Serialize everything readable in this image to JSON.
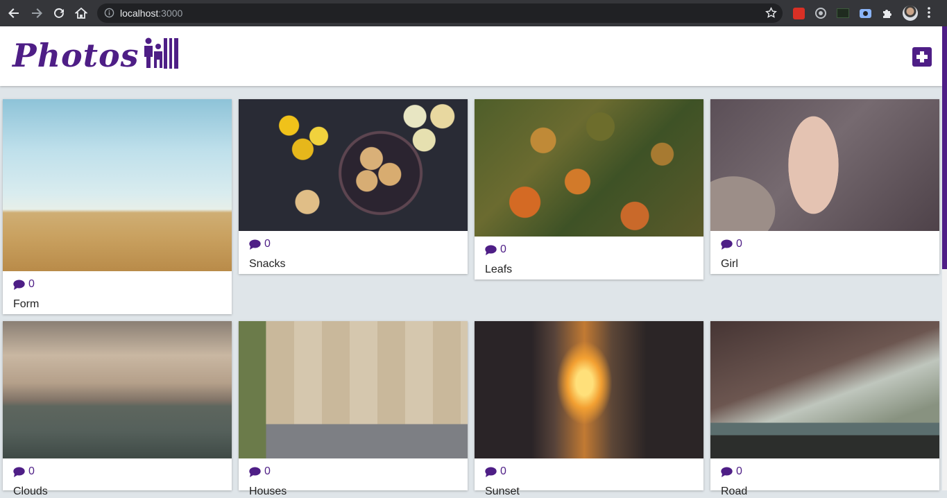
{
  "browser": {
    "url_host": "localhost",
    "url_port": ":3000"
  },
  "app": {
    "logo_text": "Photos",
    "accent_color": "#4e1e86"
  },
  "cards": [
    {
      "title": "Form",
      "comments": "0"
    },
    {
      "title": "Snacks",
      "comments": "0"
    },
    {
      "title": "Leafs",
      "comments": "0"
    },
    {
      "title": "Girl",
      "comments": "0"
    },
    {
      "title": "Clouds",
      "comments": "0"
    },
    {
      "title": "Houses",
      "comments": "0"
    },
    {
      "title": "Sunset",
      "comments": "0"
    },
    {
      "title": "Road",
      "comments": "0"
    }
  ],
  "icons": {
    "comment": "comment-icon",
    "add": "plus-square-icon"
  }
}
